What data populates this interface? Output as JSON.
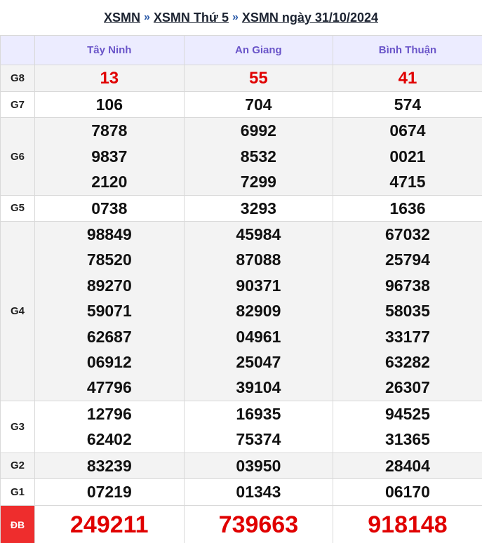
{
  "breadcrumb": {
    "items": [
      "XSMN",
      "XSMN Thứ 5",
      "XSMN ngày 31/10/2024"
    ],
    "separator": "»"
  },
  "provinces": [
    "Tây Ninh",
    "An Giang",
    "Bình Thuận"
  ],
  "prizes": {
    "g8": {
      "label": "G8",
      "values": [
        [
          "13"
        ],
        [
          "55"
        ],
        [
          "41"
        ]
      ]
    },
    "g7": {
      "label": "G7",
      "values": [
        [
          "106"
        ],
        [
          "704"
        ],
        [
          "574"
        ]
      ]
    },
    "g6": {
      "label": "G6",
      "values": [
        [
          "7878",
          "9837",
          "2120"
        ],
        [
          "6992",
          "8532",
          "7299"
        ],
        [
          "0674",
          "0021",
          "4715"
        ]
      ]
    },
    "g5": {
      "label": "G5",
      "values": [
        [
          "0738"
        ],
        [
          "3293"
        ],
        [
          "1636"
        ]
      ]
    },
    "g4": {
      "label": "G4",
      "values": [
        [
          "98849",
          "78520",
          "89270",
          "59071",
          "62687",
          "06912",
          "47796"
        ],
        [
          "45984",
          "87088",
          "90371",
          "82909",
          "04961",
          "25047",
          "39104"
        ],
        [
          "67032",
          "25794",
          "96738",
          "58035",
          "33177",
          "63282",
          "26307"
        ]
      ]
    },
    "g3": {
      "label": "G3",
      "values": [
        [
          "12796",
          "62402"
        ],
        [
          "16935",
          "75374"
        ],
        [
          "94525",
          "31365"
        ]
      ]
    },
    "g2": {
      "label": "G2",
      "values": [
        [
          "83239"
        ],
        [
          "03950"
        ],
        [
          "28404"
        ]
      ]
    },
    "g1": {
      "label": "G1",
      "values": [
        [
          "07219"
        ],
        [
          "01343"
        ],
        [
          "06170"
        ]
      ]
    },
    "db": {
      "label": "ĐB",
      "values": [
        [
          "249211"
        ],
        [
          "739663"
        ],
        [
          "918148"
        ]
      ]
    }
  },
  "colors": {
    "header_bg": "#ececff",
    "header_text": "#6a55c9",
    "highlight_red": "#e00000",
    "special_label_bg": "#ee2d2d",
    "row_gray": "#f3f3f3"
  }
}
